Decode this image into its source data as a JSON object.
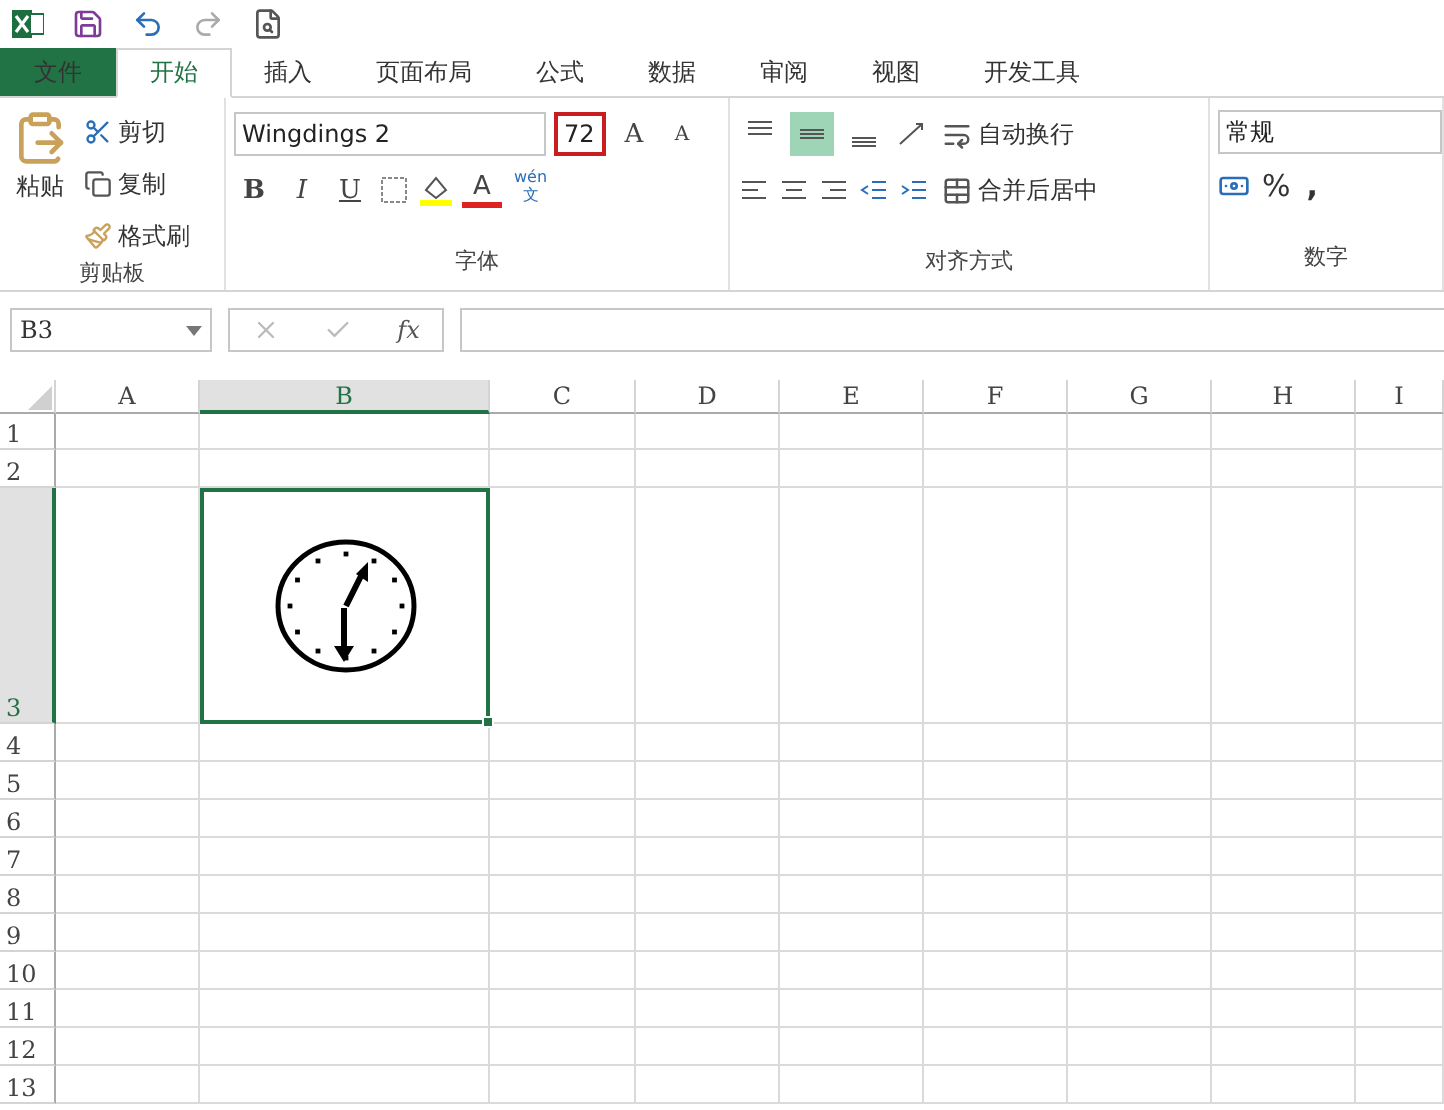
{
  "tabs": [
    {
      "label": "文件",
      "kind": "file",
      "selected": false
    },
    {
      "label": "开始",
      "kind": "tab",
      "selected": true
    },
    {
      "label": "插入",
      "kind": "tab",
      "selected": false
    },
    {
      "label": "页面布局",
      "kind": "tab",
      "selected": false
    },
    {
      "label": "公式",
      "kind": "tab",
      "selected": false
    },
    {
      "label": "数据",
      "kind": "tab",
      "selected": false
    },
    {
      "label": "审阅",
      "kind": "tab",
      "selected": false
    },
    {
      "label": "视图",
      "kind": "tab",
      "selected": false
    },
    {
      "label": "开发工具",
      "kind": "tab",
      "selected": false
    }
  ],
  "clipboard": {
    "paste": "粘贴",
    "cut": "剪切",
    "copy": "复制",
    "format_painter": "格式刷",
    "group_label": "剪贴板"
  },
  "font": {
    "name": "Wingdings 2",
    "size": "72",
    "size_highlighted": true,
    "grow": "A",
    "shrink": "A",
    "bold": "B",
    "italic": "I",
    "underline": "U",
    "font_color": "A",
    "phonetic_top": "wén",
    "phonetic_bottom": "文",
    "group_label": "字体"
  },
  "alignment": {
    "vertical": [
      {
        "selected": false
      },
      {
        "selected": true
      },
      {
        "selected": false
      }
    ],
    "wrap_text": "自动换行",
    "merge_center": "合并后居中",
    "group_label": "对齐方式"
  },
  "number": {
    "format": "常规",
    "percent": "%",
    "comma": ",",
    "group_label": "数字"
  },
  "formula_bar": {
    "name_box": "B3",
    "function_label": "fx"
  },
  "sheet": {
    "columns": [
      {
        "label": "A",
        "selected": false
      },
      {
        "label": "B",
        "selected": true
      },
      {
        "label": "C",
        "selected": false
      },
      {
        "label": "D",
        "selected": false
      },
      {
        "label": "E",
        "selected": false
      },
      {
        "label": "F",
        "selected": false
      },
      {
        "label": "G",
        "selected": false
      },
      {
        "label": "H",
        "selected": false
      },
      {
        "label": "I",
        "selected": false
      }
    ],
    "rows": [
      {
        "label": "1",
        "selected": false
      },
      {
        "label": "2",
        "selected": false
      },
      {
        "label": "3",
        "selected": true
      },
      {
        "label": "4",
        "selected": false
      },
      {
        "label": "5",
        "selected": false
      },
      {
        "label": "6",
        "selected": false
      },
      {
        "label": "7",
        "selected": false
      },
      {
        "label": "8",
        "selected": false
      },
      {
        "label": "9",
        "selected": false
      },
      {
        "label": "10",
        "selected": false
      },
      {
        "label": "11",
        "selected": false
      },
      {
        "label": "12",
        "selected": false
      },
      {
        "label": "13",
        "selected": false
      }
    ],
    "active_cell_content": {
      "kind": "clock"
    }
  }
}
